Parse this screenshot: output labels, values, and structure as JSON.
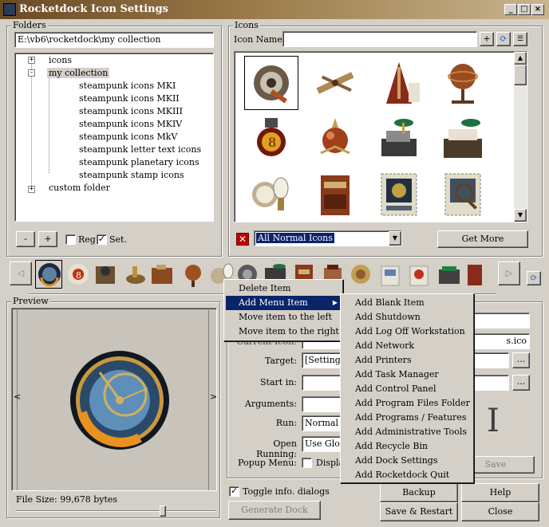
{
  "window": {
    "title": "Rocketdock Icon Settings"
  },
  "folders": {
    "legend": "Folders",
    "path": "E:\\vb6\\rocketdock\\my collection",
    "tree": [
      {
        "label": "icons",
        "expander": "+"
      },
      {
        "label": "my collection",
        "expander": "-"
      },
      {
        "label": "steampunk icons MKI"
      },
      {
        "label": "steampunk icons MKII"
      },
      {
        "label": "steampunk icons MKIII"
      },
      {
        "label": "steampunk icons MKIV"
      },
      {
        "label": "steampunk icons MkV"
      },
      {
        "label": "steampunk letter text icons"
      },
      {
        "label": "steampunk planetary icons"
      },
      {
        "label": "steampunk stamp icons"
      },
      {
        "label": "custom folder",
        "expander": "+"
      }
    ],
    "minus_label": "-",
    "plus_label": "+",
    "reg_label": "Reg.",
    "set_label": "Set."
  },
  "icons": {
    "legend": "Icons",
    "name_label": "Icon Name:",
    "name_value": "",
    "filter_value": "All Normal Icons",
    "get_more_label": "Get More"
  },
  "context_menu": {
    "items": [
      "Delete Item",
      "Add Menu Item",
      "Move item to the left",
      "Move item to the right"
    ]
  },
  "submenu": {
    "items": [
      "Add Blank Item",
      "Add Shutdown",
      "Add Log Off Workstation",
      "Add Network",
      "Add Printers",
      "Add Task Manager",
      "Add Control Panel",
      "Add Program Files Folder",
      "Add Programs / Features",
      "Add Administrative Tools",
      "Add Recycle Bin",
      "Add Dock Settings",
      "Add Rocketdock Quit"
    ]
  },
  "preview": {
    "legend": "Preview",
    "file_size": "File Size: 99,678 bytes",
    "left_arrow": "<",
    "right_arrow": ">"
  },
  "properties": {
    "current_icon_label": "Current Icon:",
    "current_icon_value_tail": "s.ico",
    "target_label": "Target:",
    "target_value": "[Settings]",
    "start_in_label": "Start in:",
    "arguments_label": "Arguments:",
    "run_label": "Run:",
    "run_value": "Normal",
    "open_running_label": "Open Running:",
    "open_running_value": "Use Glob",
    "popup_menu_label": "Popup Menu:",
    "popup_menu_text": "Displa",
    "browse_label": "...",
    "save_label": "Save",
    "text_cursor_glyph": "I"
  },
  "bottom": {
    "toggle_label": "Toggle info. dialogs",
    "generate_label": "Generate Dock",
    "backup_label": "Backup",
    "help_label": "Help",
    "save_restart_label": "Save & Restart",
    "close_label": "Close"
  },
  "colors": {
    "accent": "#0a246a",
    "titlebar": "#7a5a30",
    "delete_red": "#c00000"
  }
}
